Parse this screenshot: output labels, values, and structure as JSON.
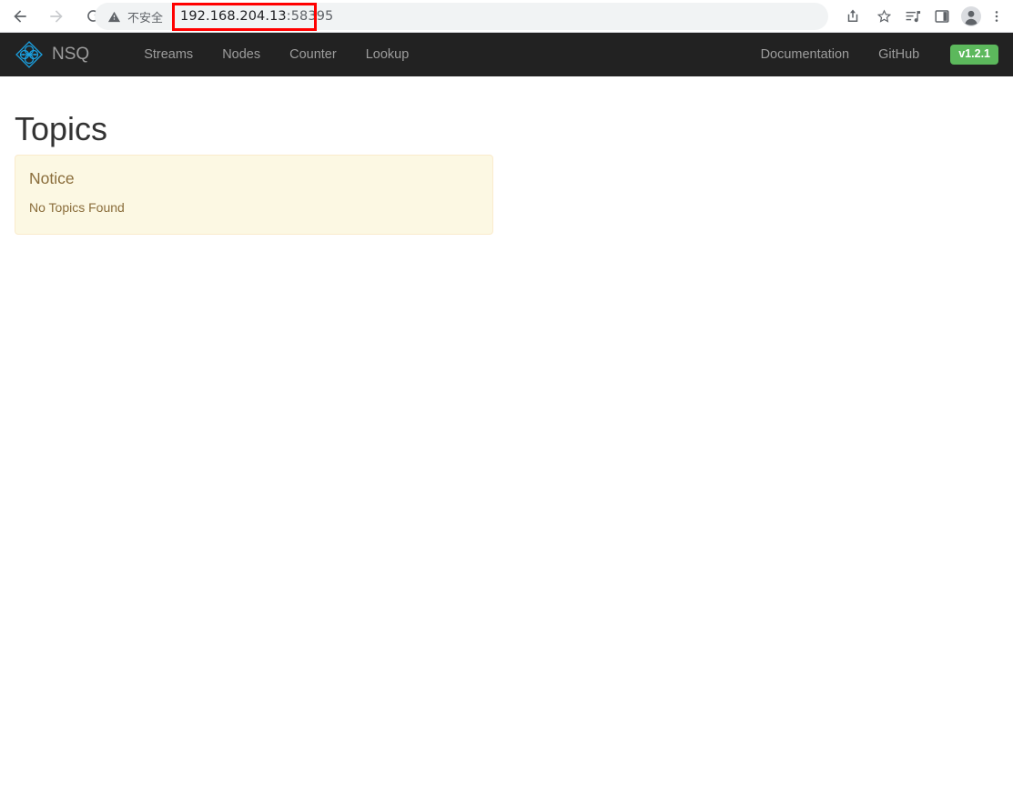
{
  "browser": {
    "back_icon": "back-arrow-icon",
    "forward_icon": "forward-arrow-icon",
    "reload_icon": "reload-icon",
    "security_icon": "warning-triangle-icon",
    "security_label": "不安全",
    "url": "192.168.204.13",
    "url_port": ":58395",
    "url_full": "192.168.204.13:58395",
    "highlight_color": "#ff0000",
    "toolbar_icons": [
      {
        "name": "share-icon",
        "glyph": "share"
      },
      {
        "name": "bookmark-star-icon",
        "glyph": "star"
      },
      {
        "name": "media-controls-icon",
        "glyph": "media"
      },
      {
        "name": "side-panel-icon",
        "glyph": "panel"
      },
      {
        "name": "profile-avatar-icon",
        "glyph": "avatar"
      },
      {
        "name": "browser-menu-icon",
        "glyph": "kebab"
      }
    ]
  },
  "navbar": {
    "brand": "NSQ",
    "brand_icon": "nsq-diamond-logo-icon",
    "brand_color": "#1ba0e0",
    "background": "#222222",
    "link_color": "#9d9d9d",
    "left_links": [
      {
        "label": "Streams"
      },
      {
        "label": "Nodes"
      },
      {
        "label": "Counter"
      },
      {
        "label": "Lookup"
      }
    ],
    "right_links": [
      {
        "label": "Documentation"
      },
      {
        "label": "GitHub"
      }
    ],
    "version": "v1.2.1",
    "version_badge_color": "#5cb85c"
  },
  "page": {
    "title": "Topics",
    "notice": {
      "title": "Notice",
      "message": "No Topics Found",
      "background": "#fcf8e3",
      "border": "#faebcc",
      "text_color": "#8a6d3b"
    }
  }
}
